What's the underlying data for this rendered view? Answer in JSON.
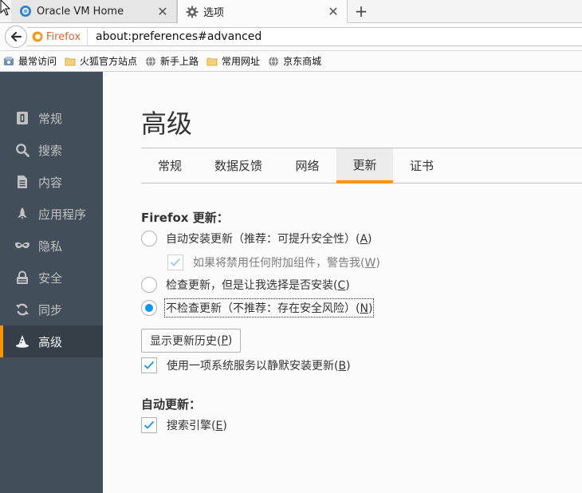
{
  "browser": {
    "tabs": [
      {
        "title": "Oracle VM Home",
        "close_glyph": "✕",
        "icon": "vm-globe-icon"
      },
      {
        "title": "选项",
        "close_glyph": "✕",
        "icon": "gear-icon"
      }
    ],
    "new_tab_glyph": "+",
    "identity_label": "Firefox",
    "url": "about:preferences#advanced"
  },
  "bookmarks": [
    {
      "label": "最常访问",
      "icon": "bookmark-folder-icon"
    },
    {
      "label": "火狐官方站点",
      "icon": "folder-icon"
    },
    {
      "label": "新手上路",
      "icon": "globe-icon"
    },
    {
      "label": "常用网址",
      "icon": "folder-icon"
    },
    {
      "label": "京东商城",
      "icon": "globe-icon"
    }
  ],
  "sidebar": {
    "items": [
      {
        "label": "常规",
        "icon": "general-icon"
      },
      {
        "label": "搜索",
        "icon": "search-icon"
      },
      {
        "label": "内容",
        "icon": "content-icon"
      },
      {
        "label": "应用程序",
        "icon": "rocket-icon"
      },
      {
        "label": "隐私",
        "icon": "mask-icon"
      },
      {
        "label": "安全",
        "icon": "lock-icon"
      },
      {
        "label": "同步",
        "icon": "sync-icon"
      },
      {
        "label": "高级",
        "icon": "wizard-hat-icon"
      }
    ],
    "selected_index": 7
  },
  "main": {
    "title": "高级",
    "tabs": [
      "常规",
      "数据反馈",
      "网络",
      "更新",
      "证书"
    ],
    "selected_tab": 3,
    "update_group_label": "Firefox 更新：",
    "options": {
      "auto_install": {
        "text": "自动安装更新（推荐：可提升安全性）(",
        "key": "A",
        "close": ")",
        "checked": false
      },
      "warn_addons": {
        "text": "如果将禁用任何附加组件，警告我(",
        "key": "W",
        "close": ")",
        "checked": true,
        "disabled": true
      },
      "check_only": {
        "text": "检查更新，但是让我选择是否安装(",
        "key": "C",
        "close": ")",
        "checked": false
      },
      "never_check": {
        "text": "不检查更新（不推荐：存在安全风险）(",
        "key": "N",
        "close": ")",
        "checked": true
      }
    },
    "history_button": {
      "text": "显示更新历史(",
      "key": "P",
      "close": ")"
    },
    "background_service": {
      "text": "使用一项系统服务以静默安装更新(",
      "key": "B",
      "close": ")",
      "checked": true
    },
    "auto_update_group_label": "自动更新：",
    "search_engines": {
      "text": "搜索引擎(",
      "key": "E",
      "close": ")",
      "checked": true
    }
  },
  "colors": {
    "accent": "#ff9500",
    "radio_selected": "#0996f8",
    "check_mark": "#0996f8",
    "sidebar_bg": "#424f5a",
    "sidebar_selected_bg": "#343f48"
  }
}
